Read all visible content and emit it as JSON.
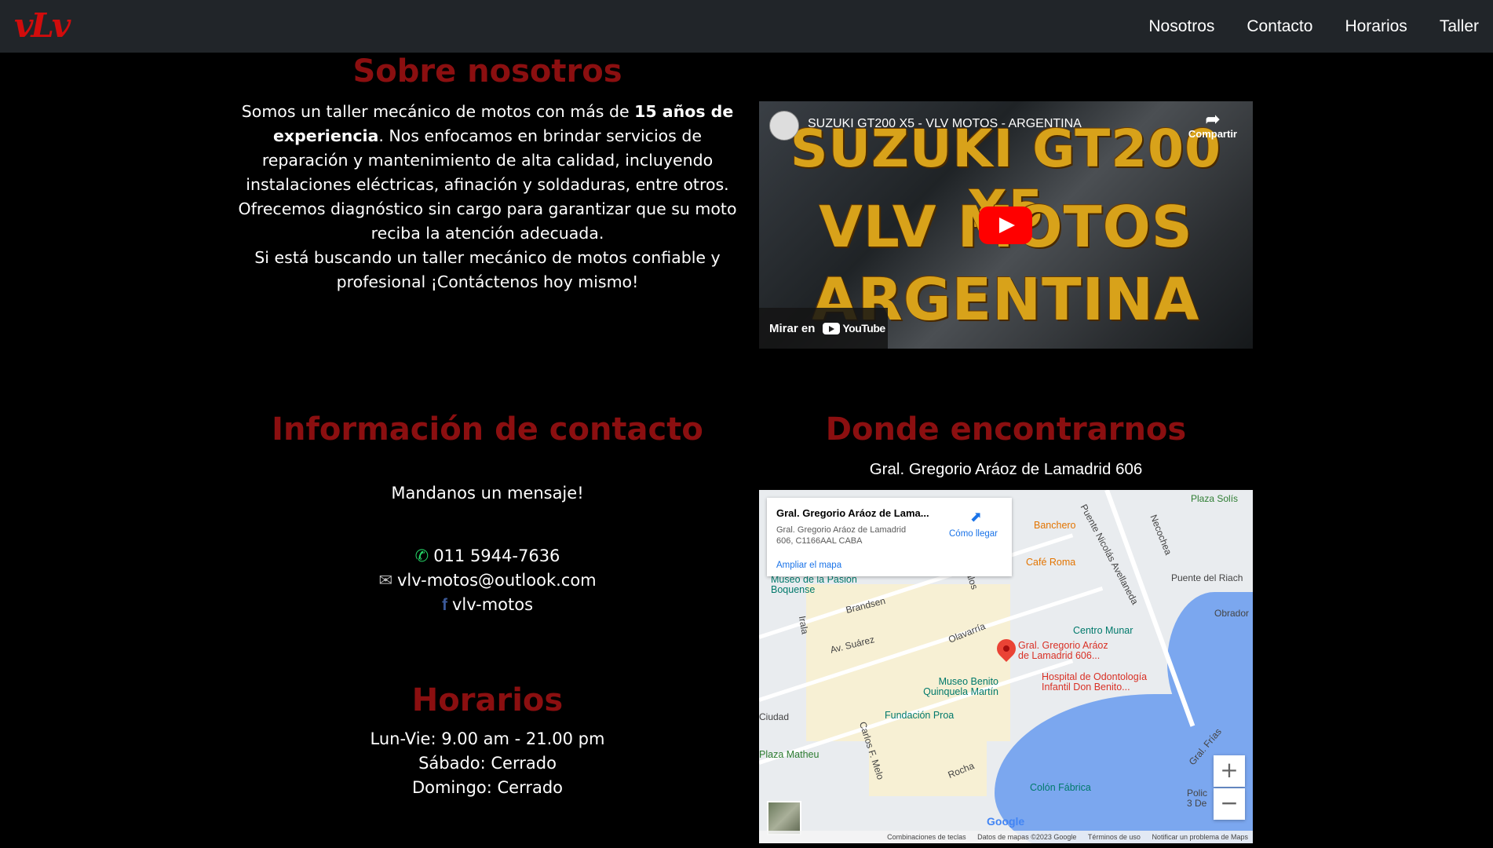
{
  "navbar": {
    "logo": "vLv",
    "links": [
      "Nosotros",
      "Contacto",
      "Horarios",
      "Taller"
    ]
  },
  "about": {
    "title": "Sobre nosotros",
    "text_before_bold": "Somos un taller mecánico de motos con más de ",
    "bold": "15 años de experiencia",
    "text_after_bold": ". Nos enfocamos en brindar servicios de reparación y mantenimiento de alta calidad, incluyendo instalaciones eléctricas, afinación y soldaduras, entre otros. Ofrecemos diagnóstico sin cargo para garantizar que su moto reciba la atención adecuada.",
    "text_second": "Si está buscando un taller mecánico de motos confiable y profesional ¡Contáctenos hoy mismo!"
  },
  "video": {
    "title": "SUZUKI GT200 X5 - VLV MOTOS - ARGENTINA",
    "thumb_lines": [
      "SUZUKI GT200 X5",
      "VLV MOTOS",
      "ARGENTINA"
    ],
    "share_label": "Compartir",
    "watch_label": "Mirar en",
    "youtube_label": "YouTube"
  },
  "contact": {
    "title": "Información de contacto",
    "subtitle": "Mandanos un mensaje!",
    "phone": "011 5944-7636",
    "email": "vlv-motos@outlook.com",
    "facebook": "vlv-motos"
  },
  "hours": {
    "title": "Horarios",
    "lines": [
      "Lun-Vie: 9.00 am - 21.00 pm",
      "Sábado: Cerrado",
      "Domingo: Cerrado"
    ]
  },
  "location": {
    "title": "Donde encontrarnos",
    "address": "Gral. Gregorio Aráoz de Lamadrid 606"
  },
  "map": {
    "card_title": "Gral. Gregorio Aráoz de Lama...",
    "card_address": "Gral. Gregorio Aráoz de Lamadrid 606, C1166AAL CABA",
    "directions": "Cómo llegar",
    "enlarge": "Ampliar el mapa",
    "pin_label": "Gral. Gregorio Aráoz de Lamadrid 606...",
    "labels": [
      "Plaza Solís",
      "Banchero",
      "Café Roma",
      "Puente del Riach",
      "Obrador",
      "Museo de la Pasión Boquense",
      "Brandsen",
      "Centro Munar",
      "Av. Suárez",
      "Olavarría",
      "Museo Benito Quinquela Martín",
      "Hospital de Odontología Infantil Don Benito...",
      "Fundación Proa",
      "Plaza Matheu",
      "Colón Fábrica",
      "Irala",
      "Carlos F. Melo",
      "Rocha",
      "Necochea",
      "Palos",
      "Puente Nicolás Avellaneda",
      "Gral. Frías",
      "Ciudad",
      "Polic 3 De"
    ],
    "footer": [
      "Combinaciones de teclas",
      "Datos de mapas ©2023 Google",
      "Términos de uso",
      "Notificar un problema de Maps"
    ],
    "google": "Google",
    "zoom_in": "+",
    "zoom_out": "−"
  }
}
